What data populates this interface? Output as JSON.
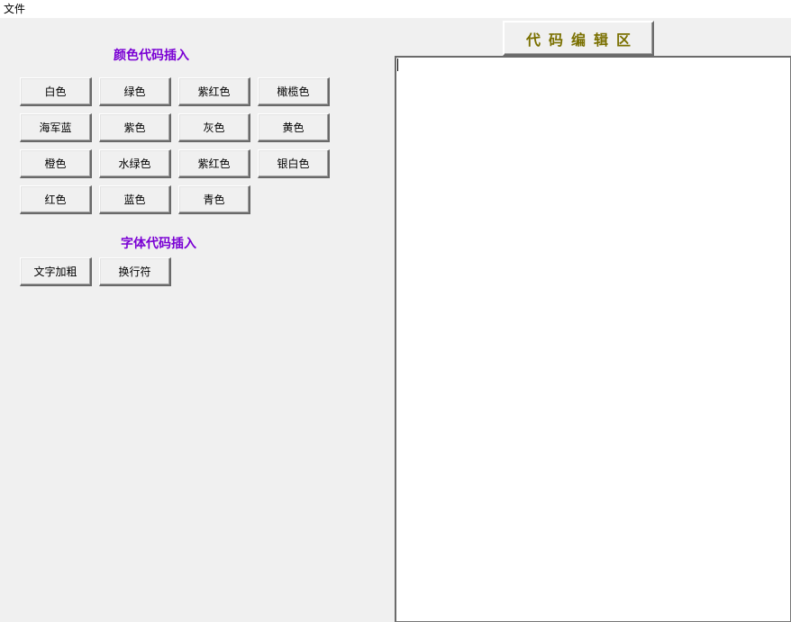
{
  "menu": {
    "file_label": "文件"
  },
  "color_section": {
    "title": "颜色代码插入",
    "buttons": [
      "白色",
      "绿色",
      "紫红色",
      "橄榄色",
      "海军蓝",
      "紫色",
      "灰色",
      "黄色",
      "橙色",
      "水绿色",
      "紫红色",
      "银白色",
      "红色",
      "蓝色",
      "青色"
    ]
  },
  "font_section": {
    "title": "字体代码插入",
    "buttons": [
      "文字加粗",
      "换行符"
    ]
  },
  "editor": {
    "header": "代码编辑区",
    "content": ""
  },
  "colors": {
    "section_title": "#7a00d4",
    "editor_header": "#7a7000",
    "window_bg": "#f0f0f0"
  }
}
